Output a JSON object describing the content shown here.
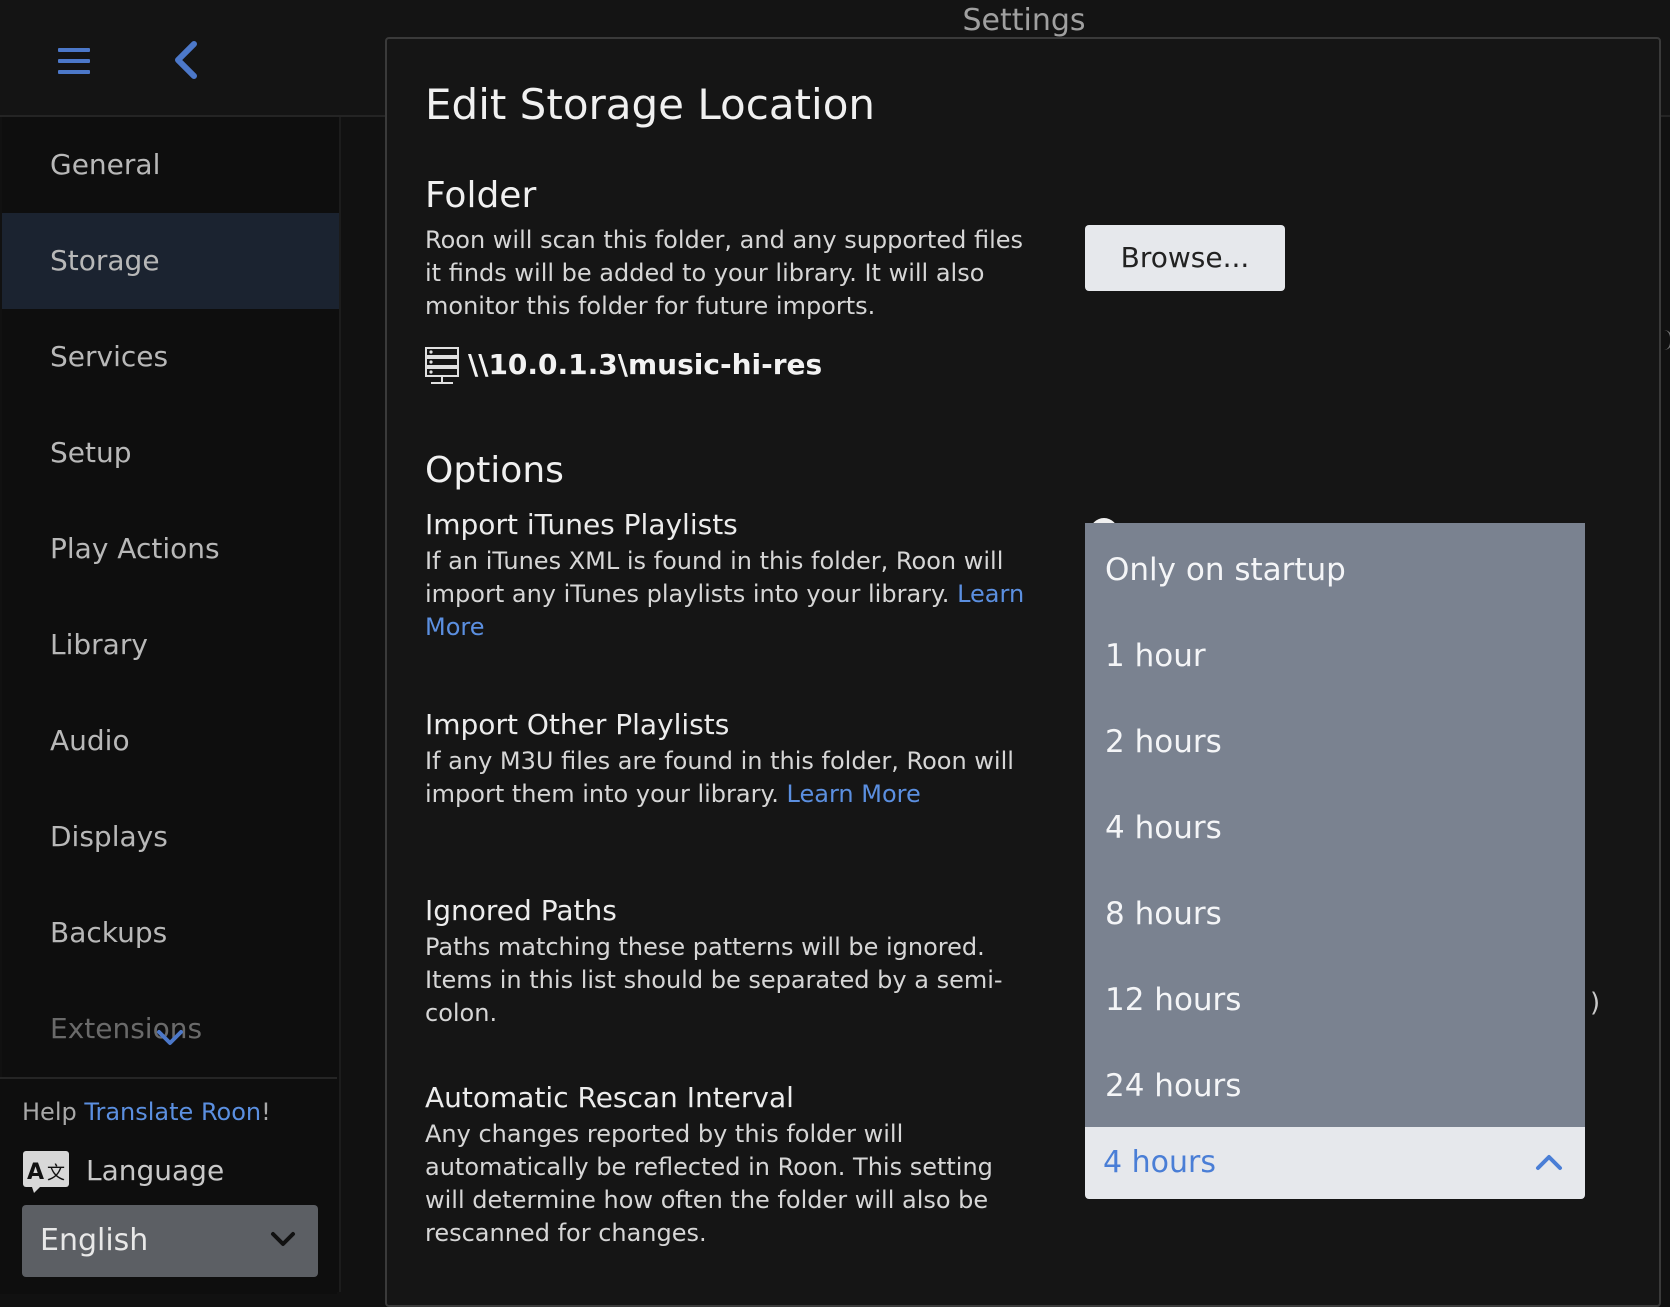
{
  "window": {
    "title": "Settings"
  },
  "sidebar": {
    "items": [
      {
        "label": "General"
      },
      {
        "label": "Storage",
        "active": true
      },
      {
        "label": "Services"
      },
      {
        "label": "Setup"
      },
      {
        "label": "Play Actions"
      },
      {
        "label": "Library"
      },
      {
        "label": "Audio"
      },
      {
        "label": "Displays"
      },
      {
        "label": "Backups"
      },
      {
        "label": "Extensions"
      }
    ],
    "footer": {
      "help_prefix": "Help ",
      "help_link": "Translate Roon",
      "help_suffix": "!",
      "language_label": "Language",
      "language_value": "English"
    }
  },
  "dialog": {
    "title": "Edit Storage Location",
    "folder": {
      "heading": "Folder",
      "description": "Roon will scan this folder, and any supported files it finds will be added to your library. It will also monitor this folder for future imports.",
      "browse_label": "Browse...",
      "path": "\\\\10.0.1.3\\music-hi-res"
    },
    "options": {
      "heading": "Options",
      "itunes": {
        "title": "Import iTunes Playlists",
        "description": "If an iTunes XML is found in this folder, Roon will import any iTunes playlists into your library.",
        "link": "Learn More"
      },
      "other": {
        "title": "Import Other Playlists",
        "description": "If any M3U files are found in this folder, Roon will import them into your library.",
        "link": "Learn More"
      },
      "ignored": {
        "title": "Ignored Paths",
        "description": "Paths matching these patterns will be ignored. Items in this list should be separated by a semi-colon.",
        "trailing_char": ")"
      },
      "rescan": {
        "title": "Automatic Rescan Interval",
        "description": "Any changes reported by this folder will automatically be reflected in Roon. This setting will determine how often the folder will also be rescanned for changes.",
        "selected": "4 hours",
        "options": [
          "Only on startup",
          "1 hour",
          "2 hours",
          "4 hours",
          "8 hours",
          "12 hours",
          "24 hours"
        ]
      }
    }
  },
  "colors": {
    "accent": "#4c78c9",
    "link": "#5b8fe0",
    "dropdown_bg": "#7a8290",
    "active_nav": "#1b2330"
  },
  "icons": [
    "hamburger-icon",
    "back-icon",
    "server-icon",
    "chevron-down-icon",
    "chevron-up-icon",
    "language-icon"
  ]
}
